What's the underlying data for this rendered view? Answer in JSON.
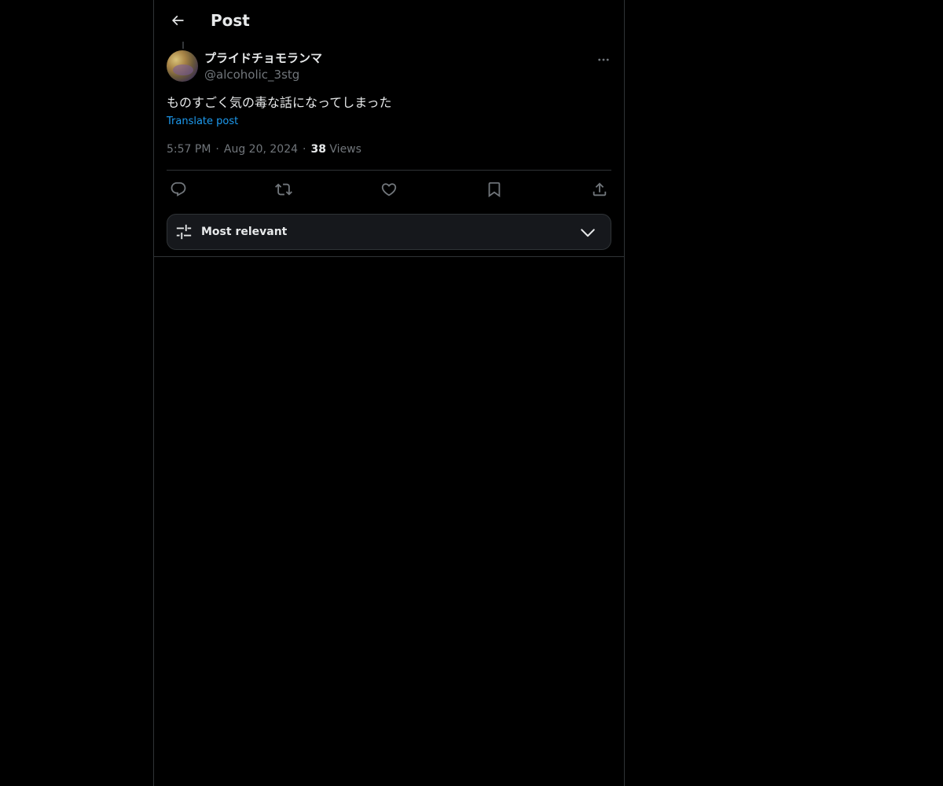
{
  "header": {
    "title": "Post",
    "back_icon": "arrow-left-icon"
  },
  "post": {
    "author": {
      "display_name": "プライドチョモランマ",
      "handle": "@alcoholic_3stg"
    },
    "text": "ものすごく気の毒な話になってしまった",
    "translate_label": "Translate post",
    "time": "5:57 PM",
    "separator": "·",
    "date": "Aug 20, 2024",
    "views_count": "38",
    "views_label": "Views"
  },
  "actions": [
    {
      "icon": "reply-icon"
    },
    {
      "icon": "repost-icon"
    },
    {
      "icon": "like-icon"
    },
    {
      "icon": "bookmark-icon"
    },
    {
      "icon": "share-icon"
    }
  ],
  "sort": {
    "label": "Most relevant",
    "icon": "sliders-icon",
    "chevron": "chevron-down-icon"
  },
  "colors": {
    "background": "#000000",
    "text_primary": "#e7e9ea",
    "text_secondary": "#71767b",
    "accent": "#1d9bf0",
    "border": "#2f3336"
  }
}
